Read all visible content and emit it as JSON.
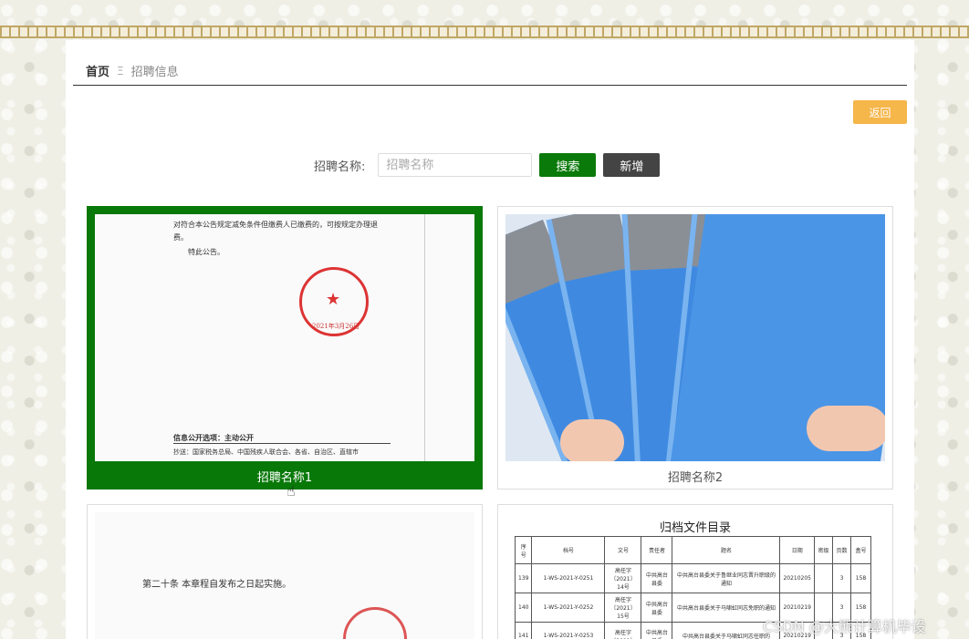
{
  "breadcrumb": {
    "home": "首页",
    "separator": "Ξ",
    "current": "招聘信息"
  },
  "back_button": "返回",
  "search": {
    "label": "招聘名称:",
    "placeholder": "招聘名称",
    "value": ""
  },
  "buttons": {
    "search": "搜索",
    "add": "新增"
  },
  "cards": [
    {
      "caption": "招聘名称1",
      "active": true,
      "doc_lines": [
        "对符合本公告规定减免条件但缴费人已缴费的，可按规定办理退",
        "费。",
        "特此公告。"
      ],
      "doc_footer": "信息公开选项：主动公开",
      "doc_footer2": "抄送：国家税务总局、中国残疾人联合会、各省、自治区、直辖市",
      "seal_text": "2021年3月26日"
    },
    {
      "caption": "招聘名称2",
      "active": false
    },
    {
      "caption": "",
      "active": false,
      "doc_text": "第二十条  本章程自发布之日起实施。"
    },
    {
      "caption": "",
      "active": false,
      "table_title": "归档文件目录",
      "headers": [
        "序号",
        "档号",
        "文号",
        "责任者",
        "题名",
        "日期",
        "密级",
        "页数",
        "盒号"
      ],
      "rows": [
        [
          "139",
          "1-WS-2021-Y-0251",
          "高任字〔2021〕14号",
          "中共高台县委",
          "中共高台县委关于鲁继业同志晋升职级的通知",
          "20210205",
          "",
          "3",
          "158"
        ],
        [
          "140",
          "1-WS-2021-Y-0252",
          "高任字〔2021〕15号",
          "中共高台县委",
          "中共高台县委关于马啸虹同志免职的通知",
          "20210219",
          "",
          "3",
          "158"
        ],
        [
          "141",
          "1-WS-2021-Y-0253",
          "高任字〔2021〕",
          "中共高台县委",
          "中共高台县委关于马啸虹同志任职的",
          "20210219",
          "",
          "3",
          "158"
        ]
      ]
    }
  ],
  "watermark": "CSDN @大熊计算机毕设",
  "colors": {
    "accent_green": "#087808",
    "back_orange": "#f5b64a",
    "add_dark": "#444444"
  }
}
